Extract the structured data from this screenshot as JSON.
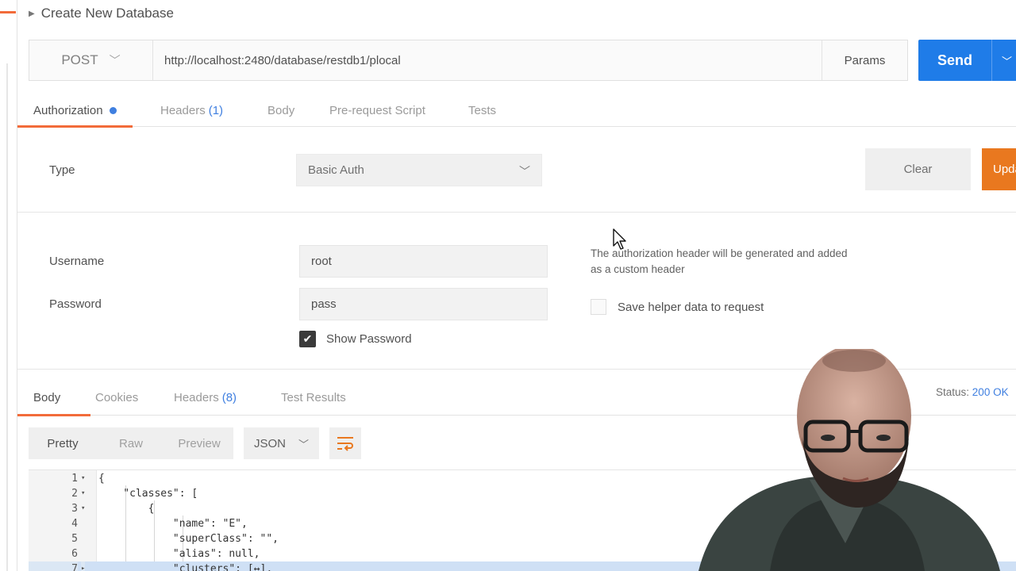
{
  "collection": {
    "title": "Create New Database"
  },
  "request": {
    "method": "POST",
    "url": "http://localhost:2480/database/restdb1/plocal",
    "params_label": "Params",
    "send_label": "Send"
  },
  "request_tabs": [
    {
      "label": "Authorization",
      "count": ""
    },
    {
      "label": "Headers",
      "count": "(1)"
    },
    {
      "label": "Body",
      "count": ""
    },
    {
      "label": "Pre-request Script",
      "count": ""
    },
    {
      "label": "Tests",
      "count": ""
    }
  ],
  "auth": {
    "type_label": "Type",
    "type_value": "Basic Auth",
    "clear_label": "Clear",
    "update_label": "Update",
    "username_label": "Username",
    "username_value": "root",
    "password_label": "Password",
    "password_value": "pass",
    "show_password_label": "Show Password",
    "helper_note": "The authorization header will be generated and added as a custom header",
    "save_helper_label": "Save helper data to request"
  },
  "response_tabs": [
    {
      "label": "Body",
      "count": ""
    },
    {
      "label": "Cookies",
      "count": ""
    },
    {
      "label": "Headers",
      "count": "(8)"
    },
    {
      "label": "Test Results",
      "count": ""
    }
  ],
  "response": {
    "status_label": "Status:",
    "status_value": "200 OK",
    "view_modes": [
      "Pretty",
      "Raw",
      "Preview"
    ],
    "format": "JSON"
  },
  "code_lines": [
    {
      "n": "1",
      "fold": "▾",
      "text": "{"
    },
    {
      "n": "2",
      "fold": "▾",
      "text": "    \"classes\": ["
    },
    {
      "n": "3",
      "fold": "▾",
      "text": "        {"
    },
    {
      "n": "4",
      "fold": "",
      "text": "            \"name\": \"E\","
    },
    {
      "n": "5",
      "fold": "",
      "text": "            \"superClass\": \"\","
    },
    {
      "n": "6",
      "fold": "",
      "text": "            \"alias\": null,"
    },
    {
      "n": "7",
      "fold": "▸",
      "text": "            \"clusters\": [↔],"
    }
  ],
  "colors": {
    "accent_orange": "#f26b3a",
    "send_blue": "#1f7ce8",
    "update_orange": "#e9781f",
    "link_blue": "#3f7fe0"
  }
}
